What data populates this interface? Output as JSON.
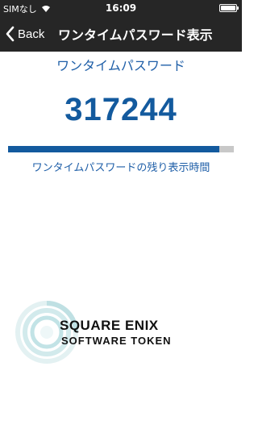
{
  "status_bar": {
    "carrier": "SIMなし",
    "time": "16:09"
  },
  "nav": {
    "back_label": "Back",
    "title": "ワンタイムパスワード表示"
  },
  "main": {
    "heading": "ワンタイムパスワード",
    "otp": "317244",
    "remaining_fraction": 0.935,
    "remaining_label": "ワンタイムパスワードの残り表示時間"
  },
  "logo": {
    "line1": "SQUARE ENIX",
    "line2": "SOFTWARE TOKEN"
  },
  "colors": {
    "bar_background": "#262626",
    "accent_blue": "#135a9e",
    "track_gray": "#c8c8c8"
  },
  "icons": [
    "wifi-icon",
    "battery-icon",
    "chevron-left-icon",
    "swirl-logo-icon"
  ]
}
